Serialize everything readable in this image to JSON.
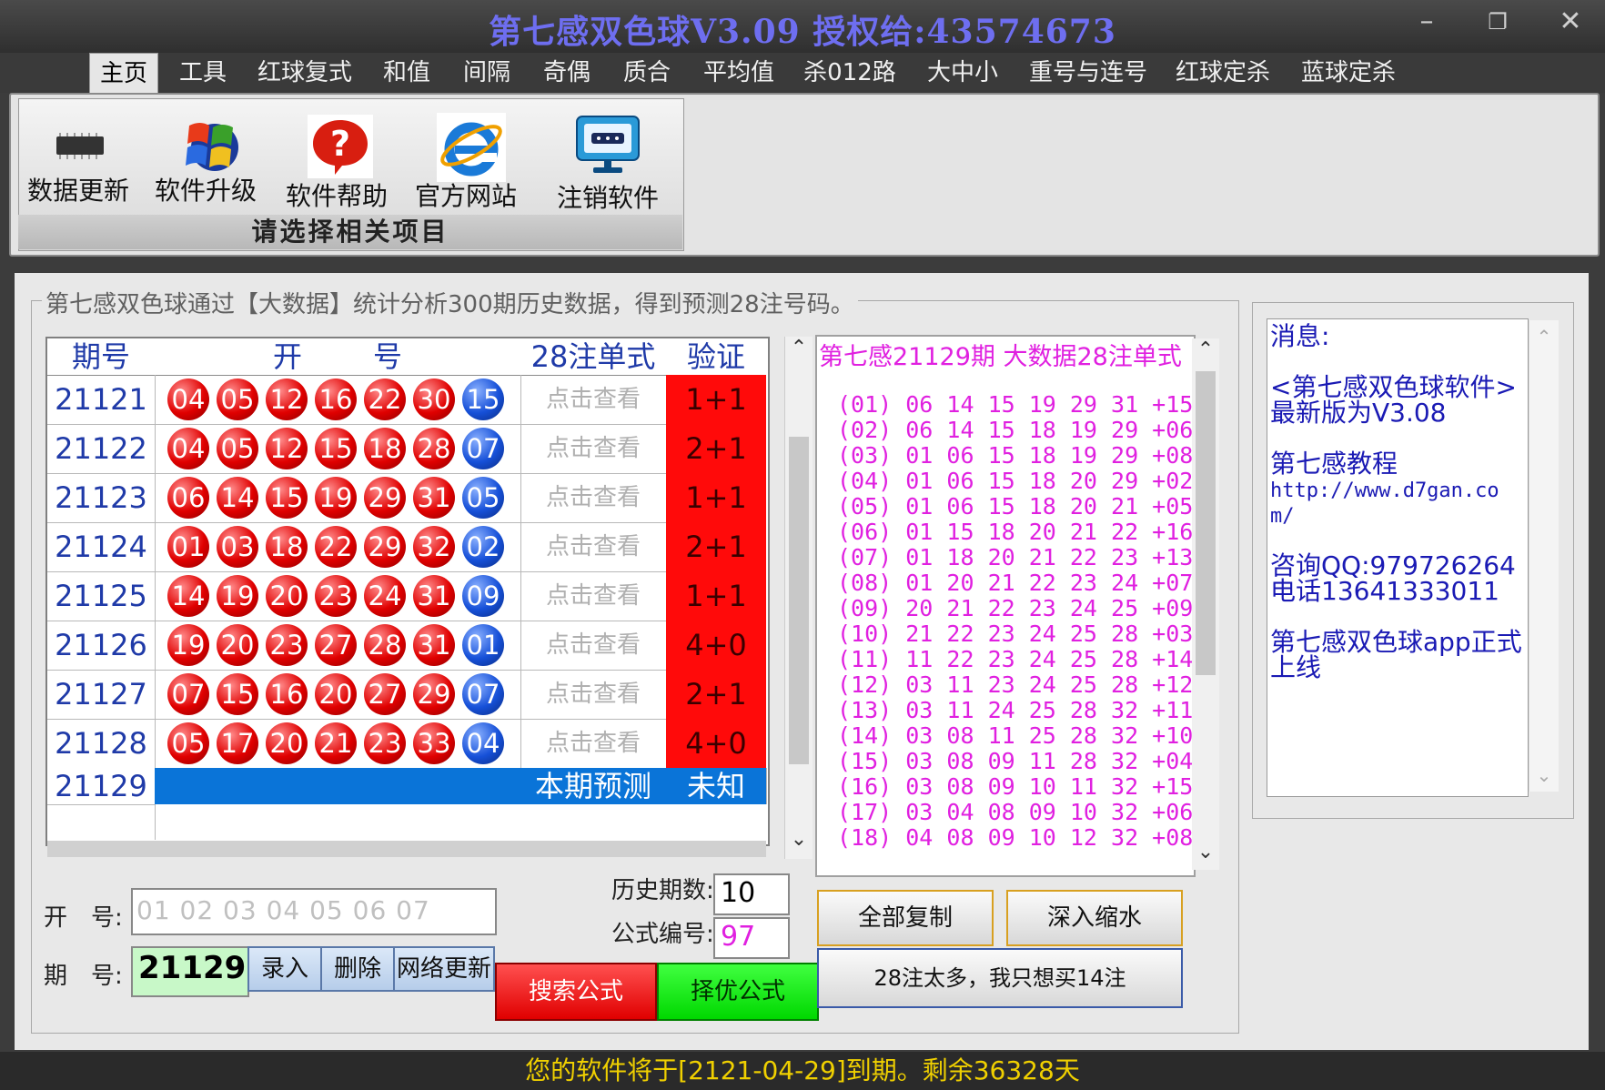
{
  "window": {
    "title": "第七感双色球V3.09  授权给:43574673",
    "minimize": "–",
    "restore": "❐",
    "close": "✕"
  },
  "tabs": [
    {
      "label": "主页",
      "active": true
    },
    {
      "label": "工具"
    },
    {
      "label": "红球复式"
    },
    {
      "label": "和值"
    },
    {
      "label": "间隔"
    },
    {
      "label": "奇偶"
    },
    {
      "label": "质合"
    },
    {
      "label": "平均值"
    },
    {
      "label": "杀012路"
    },
    {
      "label": "大中小"
    },
    {
      "label": "重号与连号"
    },
    {
      "label": "红球定杀"
    },
    {
      "label": "蓝球定杀"
    }
  ],
  "ribbon": {
    "buttons": [
      {
        "label": "数据更新",
        "icon": "chip-icon"
      },
      {
        "label": "软件升级",
        "icon": "windows-logo-icon"
      },
      {
        "label": "软件帮助",
        "icon": "help-icon"
      },
      {
        "label": "官方网站",
        "icon": "ie-icon"
      },
      {
        "label": "注销软件",
        "icon": "monitor-icon"
      }
    ],
    "caption": "请选择相关项目"
  },
  "main": {
    "group_title": "第七感双色球通过【大数据】统计分析300期历史数据，得到预测28注号码。",
    "grid": {
      "headers": [
        "期号",
        "开",
        "号",
        "28注单式",
        "验证"
      ],
      "rows": [
        {
          "issue": "21121",
          "reds": [
            "04",
            "05",
            "12",
            "16",
            "22",
            "30"
          ],
          "blue": "15",
          "view": "点击查看",
          "verify": "1+1"
        },
        {
          "issue": "21122",
          "reds": [
            "04",
            "05",
            "12",
            "15",
            "18",
            "28"
          ],
          "blue": "07",
          "view": "点击查看",
          "verify": "2+1"
        },
        {
          "issue": "21123",
          "reds": [
            "06",
            "14",
            "15",
            "19",
            "29",
            "31"
          ],
          "blue": "05",
          "view": "点击查看",
          "verify": "1+1"
        },
        {
          "issue": "21124",
          "reds": [
            "01",
            "03",
            "18",
            "22",
            "29",
            "32"
          ],
          "blue": "02",
          "view": "点击查看",
          "verify": "2+1"
        },
        {
          "issue": "21125",
          "reds": [
            "14",
            "19",
            "20",
            "23",
            "24",
            "31"
          ],
          "blue": "09",
          "view": "点击查看",
          "verify": "1+1"
        },
        {
          "issue": "21126",
          "reds": [
            "19",
            "20",
            "23",
            "27",
            "28",
            "31"
          ],
          "blue": "01",
          "view": "点击查看",
          "verify": "4+0"
        },
        {
          "issue": "21127",
          "reds": [
            "07",
            "15",
            "16",
            "20",
            "27",
            "29"
          ],
          "blue": "07",
          "view": "点击查看",
          "verify": "2+1"
        },
        {
          "issue": "21128",
          "reds": [
            "05",
            "17",
            "20",
            "21",
            "23",
            "33"
          ],
          "blue": "04",
          "view": "点击查看",
          "verify": "4+0"
        }
      ],
      "current": {
        "issue": "21129",
        "view": "本期预测",
        "verify": "未知"
      },
      "scroll_up": "⌃",
      "scroll_down": "⌄"
    },
    "prediction": {
      "title": "第七感21129期 大数据28注单式",
      "lines": [
        "(01) 06 14 15 19 29 31 +15",
        "(02) 06 14 15 18 19 29 +06",
        "(03) 01 06 15 18 19 29 +08",
        "(04) 01 06 15 18 20 29 +02",
        "(05) 01 06 15 18 20 21 +05",
        "(06) 01 15 18 20 21 22 +16",
        "(07) 01 18 20 21 22 23 +13",
        "(08) 01 20 21 22 23 24 +07",
        "(09) 20 21 22 23 24 25 +09",
        "(10) 21 22 23 24 25 28 +03",
        "(11) 11 22 23 24 25 28 +14",
        "(12) 03 11 23 24 25 28 +12",
        "(13) 03 11 24 25 28 32 +11",
        "(14) 03 08 11 25 28 32 +10",
        "(15) 03 08 09 11 28 32 +04",
        "(16) 03 08 09 10 11 32 +15",
        "(17) 03 04 08 09 10 32 +06",
        "(18) 04 08 09 10 12 32 +08"
      ]
    },
    "messages": [
      "消息:",
      "<第七感双色球软件>最新版为V3.08",
      "第七感教程",
      "http://www.d7gan.com/",
      "咨询QQ:979726264",
      "电话13641333011",
      "第七感双色球app正式上线"
    ],
    "controls": {
      "draw_label": "开　号:",
      "draw_placeholder": "01 02 03 04 05 06 07",
      "issue_label": "期　号:",
      "issue_value": "21129",
      "enter_btn": "录入",
      "delete_btn": "删除",
      "network_btn": "网络更新",
      "history_label": "历史期数:",
      "history_value": "10",
      "formula_label": "公式编号:",
      "formula_value": "97",
      "search_btn": "搜索公式",
      "best_btn": "择优公式",
      "copy_btn": "全部复制",
      "shrink_btn": "深入缩水",
      "buy14_btn": "28注太多，我只想买14注"
    }
  },
  "status": "您的软件将于[2121-04-29]到期。剩余36328天",
  "colors": {
    "title": "#6e6ef0",
    "verify_bg": "#ff0a0a",
    "selected_row": "#0a74d8",
    "prediction_text": "#e020e0",
    "message_text": "#1a1ab4",
    "status_text": "#f0d000"
  }
}
